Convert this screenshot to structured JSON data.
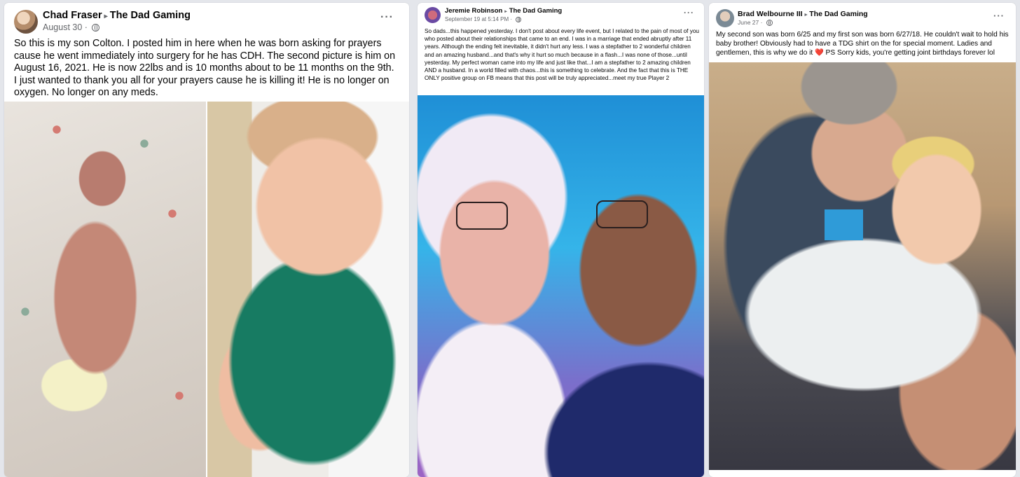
{
  "posts": [
    {
      "author": "Chad Fraser",
      "group": "The Dad Gaming",
      "timestamp": "August 30",
      "more_label": "···",
      "text": "So this is my son Colton. I posted him in here when he was born asking for prayers cause he went immediately into surgery for he has CDH. The second picture is him on August 16, 2021. He is now 22lbs and is 10 months about to be 11 months on the 9th.\nI just wanted to thank you all for your prayers cause he is killing it! He is no longer on oxygen. No longer on any meds."
    },
    {
      "author": "Jeremie Robinson",
      "group": "The Dad Gaming",
      "timestamp": "September 19 at 5:14 PM",
      "more_label": "···",
      "text": "So dads...this happened yesterday. I don't post about every life event, but I related to the pain of most of you who posted about their relationships that came to an end. I was in a marriage that ended abruptly after 11 years. Although the ending felt inevitable, it didn't hurt any less. I was a stepfather to 2 wonderful children and an amazing husband...and that's why it hurt so much because in a flash...I was none of those...until yesterday. My perfect woman came into my life and just like that...I am a stepfather to 2 amazing children AND a husband. In a world filled with chaos...this is something to celebrate. And the fact that this is THE ONLY positive group on FB means that this post will be truly appreciated...meet my true Player 2"
    },
    {
      "author": "Brad Welbourne III",
      "group": "The Dad Gaming",
      "timestamp": "June 27",
      "more_label": "···",
      "text_before": "My second son was born 6/25 and my first son was born 6/27/18. He couldn't wait to hold his baby brother! Obviously had to have a TDG shirt on the for special moment. Ladies and gentlemen, this is why we do it ",
      "heart": "❤️",
      "text_after": " PS Sorry kids, you're getting joint birthdays forever lol"
    }
  ],
  "colors": {
    "page_bg": "#e4e6eb",
    "card_bg": "#ffffff",
    "primary_text": "#050505",
    "secondary_text": "#65676b",
    "heart": "#e41e3f"
  },
  "icons": {
    "separator": "▸",
    "audience": "globe-icon",
    "menu": "more-options-icon"
  }
}
